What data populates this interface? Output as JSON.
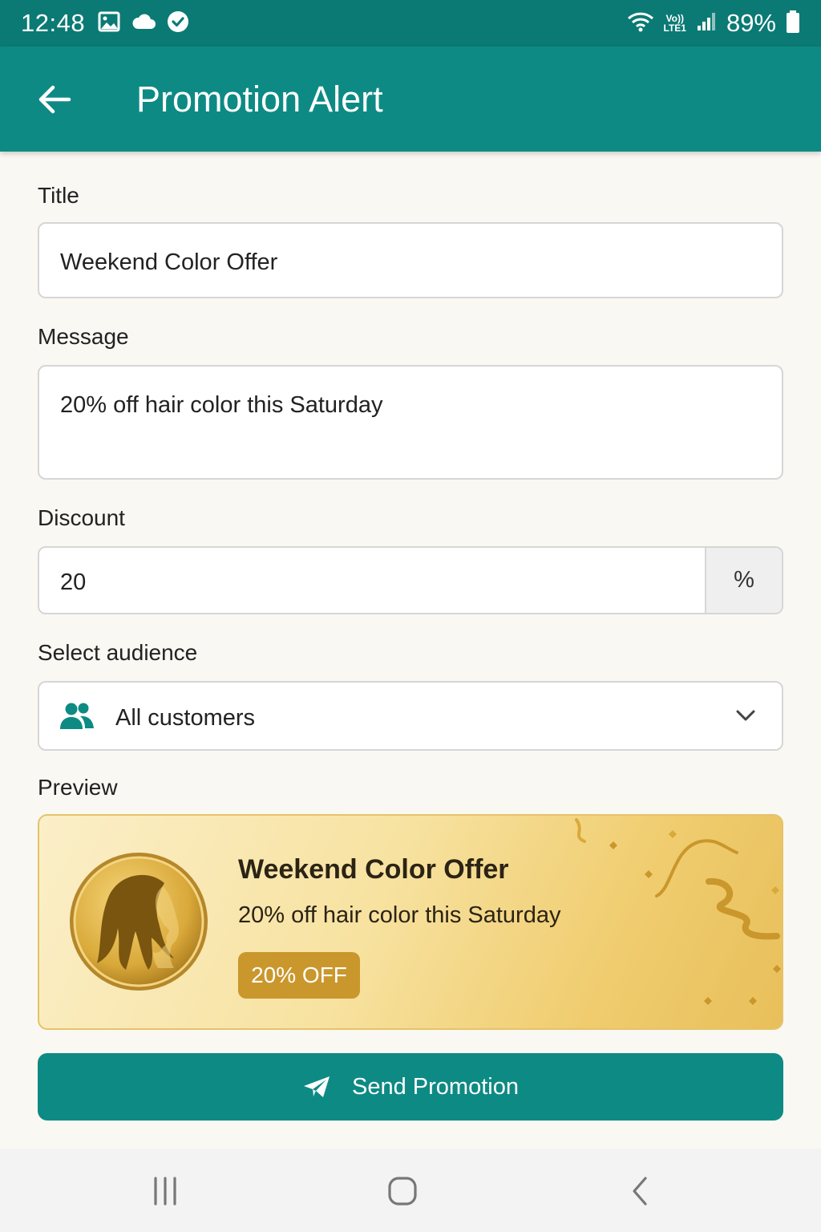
{
  "status_bar": {
    "time": "12:48",
    "battery": "89%",
    "network": "LTE1",
    "volte": "Vo))",
    "icons": [
      "gallery-icon",
      "cloud-icon",
      "check-circle-icon",
      "wifi-icon",
      "volte-icon",
      "signal-icon",
      "battery-icon"
    ]
  },
  "app_bar": {
    "title": "Promotion Alert",
    "back_icon": "arrow-left-icon"
  },
  "form": {
    "title_label": "Title",
    "title_value": "Weekend Color Offer",
    "message_label": "Message",
    "message_value": "20% off hair color this Saturday",
    "discount_label": "Discount",
    "discount_value": "20",
    "discount_unit": "%",
    "audience_label": "Select audience",
    "audience_value": "All customers",
    "audience_icon": "people-icon",
    "dropdown_icon": "chevron-down-icon"
  },
  "preview": {
    "label": "Preview",
    "title": "Weekend Color Offer",
    "message": "20% off hair color this Saturday",
    "badge": "20% OFF",
    "image_icon": "woman-profile-medallion-icon"
  },
  "send_button": {
    "label": "Send Promotion",
    "icon": "paper-plane-icon"
  },
  "nav_bar": {
    "icons": [
      "recent-apps-icon",
      "home-icon",
      "back-icon"
    ]
  },
  "colors": {
    "primary": "#0e8a84",
    "status_bar": "#0b7a74",
    "gold": "#c9972c",
    "background": "#faf8f3"
  }
}
